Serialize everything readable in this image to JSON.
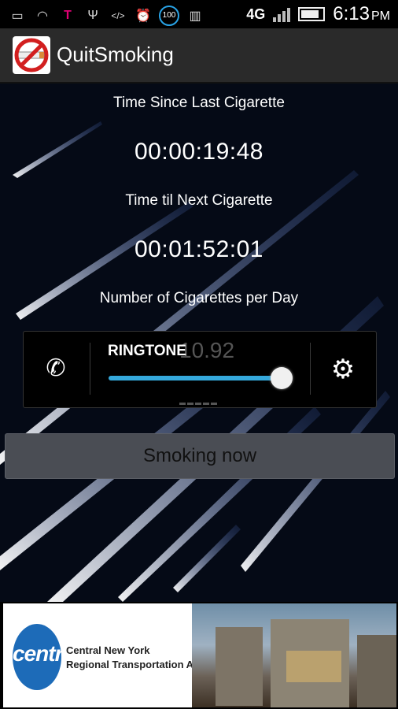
{
  "status_bar": {
    "network": "4G",
    "time": "6:13",
    "ampm": "PM",
    "badge": "100",
    "icons": [
      "gallery-icon",
      "wifi-icon",
      "tmobile-icon",
      "usb-icon",
      "code-icon",
      "alarm-icon",
      "badge-icon",
      "barcode-icon"
    ]
  },
  "app": {
    "title": "QuitSmoking"
  },
  "main": {
    "label_since": "Time Since Last Cigarette",
    "time_since": "00:00:19:48",
    "label_next": "Time til Next Cigarette",
    "time_next": "00:01:52:01",
    "label_per_day": "Number of Cigarettes per Day"
  },
  "volume_dialog": {
    "label": "RINGTONE",
    "ghost_value": "10.92",
    "level": 0.95
  },
  "buttons": {
    "smoking_now": "Smoking now"
  },
  "ad": {
    "brand": "centro",
    "line1": "Central New York",
    "line2": "Regional Transportation Authority"
  },
  "colors": {
    "accent": "#35a9dc",
    "background": "#050a16",
    "actionbar": "#2a2a2a",
    "button": "#4a4d54"
  }
}
